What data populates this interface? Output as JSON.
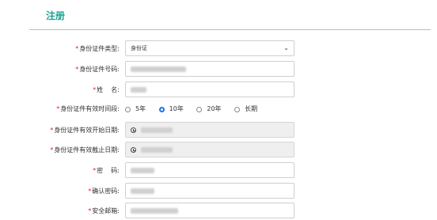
{
  "page": {
    "title": "注册"
  },
  "form": {
    "id_type": {
      "label": "身份证件类型:",
      "value": "身份证"
    },
    "id_number": {
      "label": "身份证件号码:"
    },
    "name": {
      "label": "姓    名:"
    },
    "validity": {
      "label": "身份证件有效时间段:",
      "options": [
        {
          "label": "5年",
          "selected": false
        },
        {
          "label": "10年",
          "selected": true
        },
        {
          "label": "20年",
          "selected": false
        },
        {
          "label": "长期",
          "selected": false
        }
      ]
    },
    "start_date": {
      "label": "身份证件有效开始日期:"
    },
    "end_date": {
      "label": "身份证件有效截止日期:"
    },
    "password": {
      "label": "密    码:"
    },
    "confirm_password": {
      "label": "确认密码:"
    },
    "security_email": {
      "label": "安全邮箱:"
    }
  },
  "colors": {
    "accent": "#1aa394",
    "required": "#e02020",
    "radio_selected": "#1a73e8"
  }
}
